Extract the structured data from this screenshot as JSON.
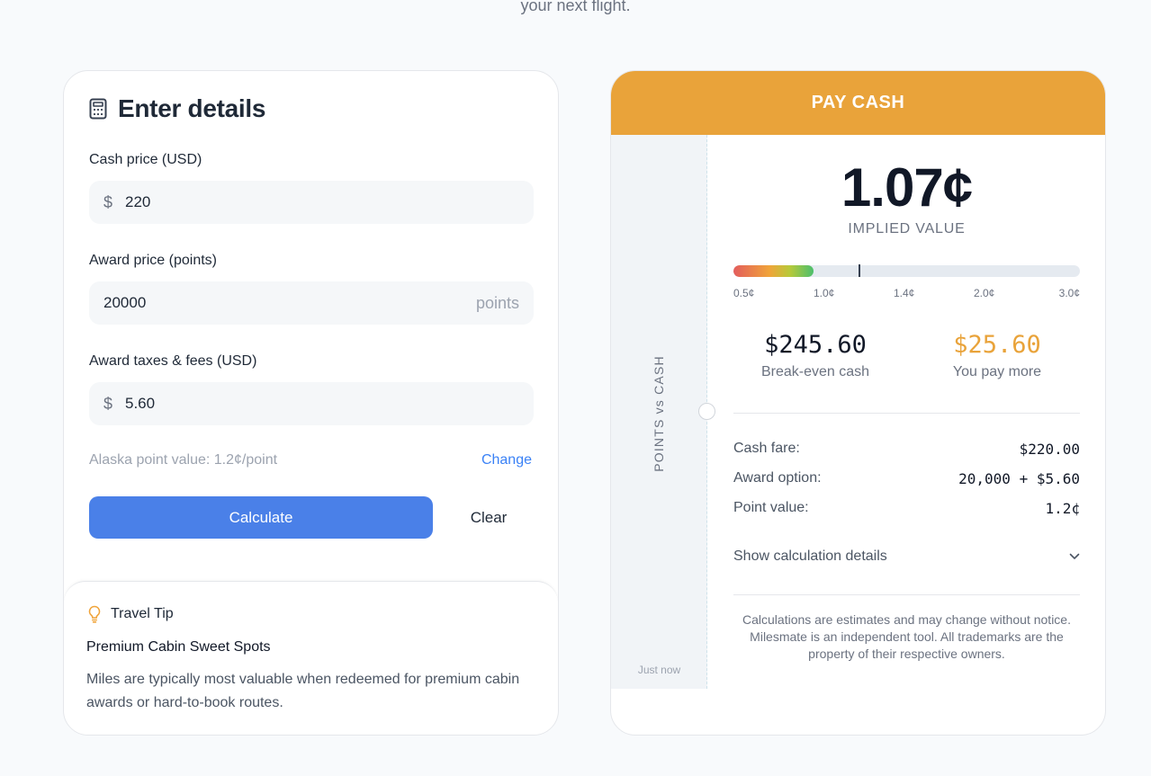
{
  "header": {
    "caption": "your next flight."
  },
  "form": {
    "title": "Enter details",
    "cash_label": "Cash price (USD)",
    "cash_prefix": "$",
    "cash_value": "220",
    "award_label": "Award price (points)",
    "award_value": "20000",
    "award_suffix": "points",
    "fees_label": "Award taxes & fees (USD)",
    "fees_prefix": "$",
    "fees_value": "5.60",
    "point_note": "Alaska point value: 1.2¢/point",
    "change_label": "Change",
    "calculate_label": "Calculate",
    "clear_label": "Clear"
  },
  "tip": {
    "heading": "Travel Tip",
    "title": "Premium Cabin Sweet Spots",
    "text": "Miles are typically most valuable when redeemed for premium cabin awards or hard-to-book routes."
  },
  "result": {
    "verdict": "PAY CASH",
    "stub_label": "POINTS vs CASH",
    "timestamp": "Just now",
    "implied_value": "1.07¢",
    "implied_label": "IMPLIED VALUE",
    "scale": {
      "ticks": [
        "0.5¢",
        "1.0¢",
        "1.4¢",
        "2.0¢",
        "3.0¢"
      ],
      "fill_fraction": 0.23,
      "marker_fraction": 0.36
    },
    "breakeven_value": "$245.60",
    "breakeven_label": "Break-even cash",
    "pay_more_value": "$25.60",
    "pay_more_label": "You pay more",
    "rows": [
      {
        "label": "Cash fare:",
        "value": "$220.00"
      },
      {
        "label": "Award option:",
        "value": "20,000 + $5.60"
      },
      {
        "label": "Point value:",
        "value": "1.2¢"
      }
    ],
    "details_label": "Show calculation details",
    "disclaimer": "Calculations are estimates and may change without notice. Milesmate is an independent tool. All trademarks are the property of their respective owners."
  },
  "colors": {
    "accent_blue": "#4a80e8",
    "verdict_orange": "#e9a33a",
    "pay_more_orange": "#e9a33a"
  }
}
